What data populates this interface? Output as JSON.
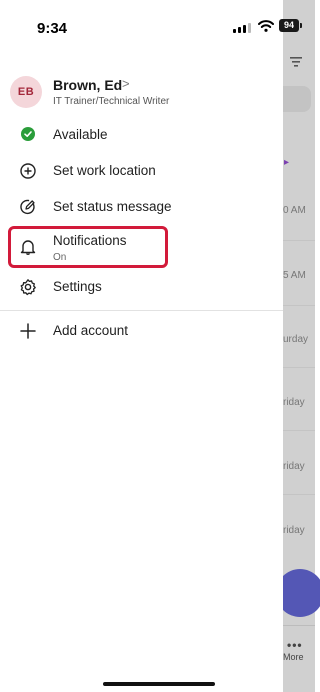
{
  "status_bar": {
    "time": "9:34",
    "battery": "94"
  },
  "profile": {
    "initials": "EB",
    "name": "Brown, Ed",
    "chevron": ">",
    "title": "IT Trainer/Technical Writer"
  },
  "menu": [
    {
      "label": "Available",
      "icon": "presence-available-icon"
    },
    {
      "label": "Set work location",
      "icon": "location-plus-icon"
    },
    {
      "label": "Set status message",
      "icon": "edit-status-icon"
    },
    {
      "label": "Notifications",
      "sub": "On",
      "icon": "bell-icon"
    },
    {
      "label": "Settings",
      "icon": "gear-icon"
    },
    {
      "label": "Add account",
      "icon": "plus-icon"
    }
  ],
  "background": {
    "times": [
      "0 AM",
      "5 AM",
      "urday",
      "riday",
      "riday",
      "riday"
    ],
    "more_label": "More"
  },
  "colors": {
    "accent_red": "#d21a3a",
    "available_green": "#2a9d3a",
    "avatar_bg": "#f4d6da",
    "fab": "#5457b5"
  }
}
